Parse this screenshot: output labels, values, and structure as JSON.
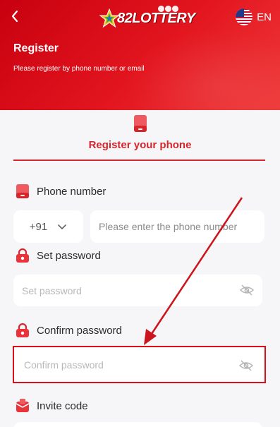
{
  "header": {
    "title": "Register",
    "subtitle": "Please register by phone number or email",
    "logo_text": "82LOTTERY",
    "language": "EN",
    "back_icon": "chevron-left-icon",
    "flag_icon": "us-flag-icon"
  },
  "tab": {
    "label": "Register your phone",
    "icon": "phone-icon"
  },
  "phone": {
    "label": "Phone number",
    "country_code": "+91",
    "placeholder": "Please enter the phone number"
  },
  "password": {
    "label": "Set password",
    "placeholder": "Set password"
  },
  "confirm": {
    "label": "Confirm password",
    "placeholder": "Confirm password"
  },
  "invite": {
    "label": "Invite code"
  },
  "colors": {
    "primary": "#d5262c",
    "header": "#e3161f",
    "highlight": "#d8101a",
    "background": "#f6f6f8"
  }
}
